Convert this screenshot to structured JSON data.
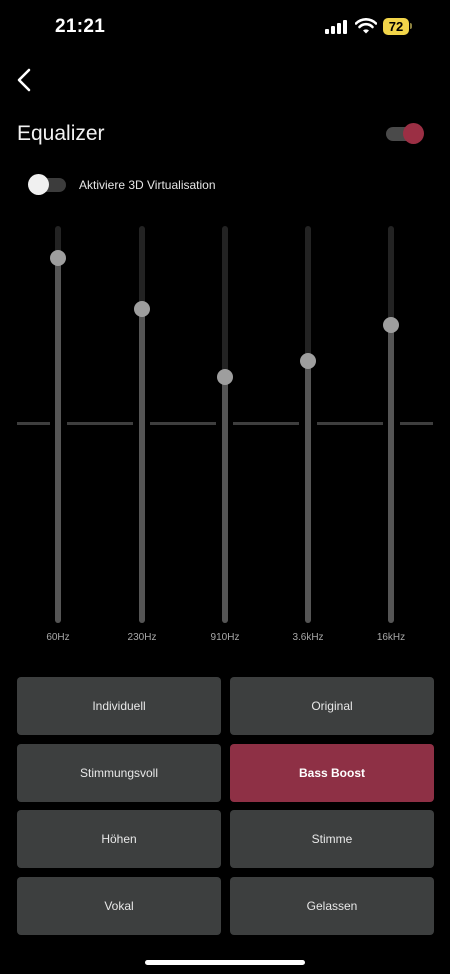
{
  "status_bar": {
    "time": "21:21",
    "battery": "72"
  },
  "header": {
    "title": "Equalizer",
    "enabled": true
  },
  "virtualization": {
    "label": "Aktiviere 3D Virtualisation",
    "enabled": false
  },
  "equalizer": {
    "bands": [
      {
        "label": "60Hz",
        "level": 0.92
      },
      {
        "label": "230Hz",
        "level": 0.79
      },
      {
        "label": "910Hz",
        "level": 0.62
      },
      {
        "label": "3.6kHz",
        "level": 0.66
      },
      {
        "label": "16kHz",
        "level": 0.75
      }
    ]
  },
  "presets": [
    {
      "label": "Individuell",
      "active": false
    },
    {
      "label": "Original",
      "active": false
    },
    {
      "label": "Stimmungsvoll",
      "active": false
    },
    {
      "label": "Bass Boost",
      "active": true
    },
    {
      "label": "Höhen",
      "active": false
    },
    {
      "label": "Stimme",
      "active": false
    },
    {
      "label": "Vokal",
      "active": false
    },
    {
      "label": "Gelassen",
      "active": false
    }
  ],
  "colors": {
    "accent": "#8e3045",
    "background": "#000000",
    "preset_button": "#3d3f3f",
    "battery": "#f2d54a"
  }
}
